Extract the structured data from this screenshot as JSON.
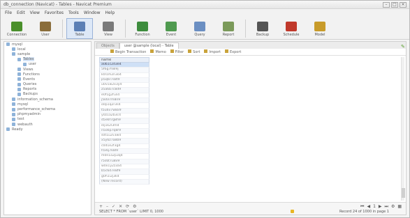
{
  "window": {
    "title": "db_connection (Navicat) - Tables - Navicat Premium",
    "btn_min": "–",
    "btn_max": "□",
    "btn_close": "×"
  },
  "menubar": [
    "File",
    "Edit",
    "View",
    "Favorites",
    "Tools",
    "Window",
    "Help"
  ],
  "toolbar": [
    {
      "label": "Connection",
      "icon": "plug-icon",
      "color": "#4a8f2b"
    },
    {
      "label": "User",
      "icon": "user-icon",
      "color": "#8a6d3b"
    },
    {
      "label": "Table",
      "icon": "table-icon",
      "color": "#5b7fb5",
      "active": true
    },
    {
      "label": "View",
      "icon": "view-icon",
      "color": "#7a7a7a"
    },
    {
      "label": "Function",
      "icon": "function-icon",
      "color": "#3d8c3d"
    },
    {
      "label": "Event",
      "icon": "event-icon",
      "color": "#4f9a4f"
    },
    {
      "label": "Query",
      "icon": "query-icon",
      "color": "#6b8fc2"
    },
    {
      "label": "Report",
      "icon": "report-icon",
      "color": "#7b9a5a"
    },
    {
      "label": "Backup",
      "icon": "backup-icon",
      "color": "#555555"
    },
    {
      "label": "Schedule",
      "icon": "schedule-icon",
      "color": "#c0392b"
    },
    {
      "label": "Model",
      "icon": "model-icon",
      "color": "#c89b2a"
    }
  ],
  "tree": [
    {
      "label": "mysql",
      "indent": 0
    },
    {
      "label": "local",
      "indent": 1
    },
    {
      "label": "sample",
      "indent": 1
    },
    {
      "label": "Tables",
      "indent": 2,
      "selected": true
    },
    {
      "label": "user",
      "indent": 3
    },
    {
      "label": "Views",
      "indent": 2
    },
    {
      "label": "Functions",
      "indent": 2
    },
    {
      "label": "Events",
      "indent": 2
    },
    {
      "label": "Queries",
      "indent": 2
    },
    {
      "label": "Reports",
      "indent": 2
    },
    {
      "label": "Backups",
      "indent": 2
    },
    {
      "label": "information_schema",
      "indent": 1
    },
    {
      "label": "mysql",
      "indent": 1
    },
    {
      "label": "performance_schema",
      "indent": 1
    },
    {
      "label": "phpmyadmin",
      "indent": 1
    },
    {
      "label": "test",
      "indent": 1
    },
    {
      "label": "webauth",
      "indent": 1
    },
    {
      "label": "Ready",
      "indent": 0
    }
  ],
  "tabs": [
    {
      "label": "Objects",
      "active": false
    },
    {
      "label": "user @sample (local) - Table",
      "active": true
    }
  ],
  "subbar": [
    "Begin Transaction",
    "Memo",
    "Filter",
    "Sort",
    "Import",
    "Export"
  ],
  "grid": {
    "header": "name",
    "rows": [
      "a0b1c2d3e4",
      "5f6g7h8i9j",
      "k0l1m2n3o4",
      "p5q6r7s8t9",
      "u0v1w2x3y4",
      "z5a6b7c8d9",
      "e0f1g2h3i4",
      "j5k6l7m8n9",
      "o0p1q2r3s4",
      "t5u6v7w8x9",
      "y0z1a2b3c4",
      "d5e6f7g8h9",
      "i0j1k2l3m4",
      "n5o6p7q8r9",
      "s0t1u2v3w4",
      "x5y6z7a8b9",
      "c0d1e2f3g4",
      "h5i6j7k8l9",
      "m0n1o2p3q4",
      "r5s6t7u8v9",
      "w0x1y2z3a4",
      "b5c6d7e8f9",
      "g0h1i2j3k4",
      "(New record)"
    ]
  },
  "bottom": {
    "nav": [
      "+",
      "–",
      "✓",
      "✕",
      "⟳",
      "⚙"
    ],
    "sql": "SELECT * FROM `user` LIMIT 0, 1000",
    "pager": [
      "⏮",
      "◀",
      "1",
      "▶",
      "⏭",
      "⚙",
      "▦"
    ],
    "records": "Record 24 of 1000 in page 1"
  }
}
